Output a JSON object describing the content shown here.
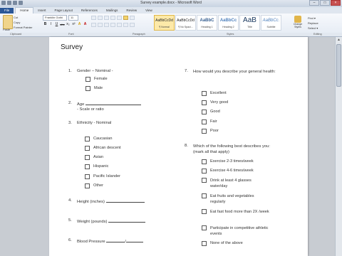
{
  "window": {
    "title": "Survey example.docx - Microsoft Word",
    "controls": [
      "–",
      "□",
      "×"
    ]
  },
  "ribbon": {
    "tabs": [
      "File",
      "Home",
      "Insert",
      "Page Layout",
      "References",
      "Mailings",
      "Review",
      "View"
    ],
    "clipboard": {
      "paste": "Paste",
      "cut": "Cut",
      "copy": "Copy",
      "format_painter": "Format Painter"
    },
    "font_name": "Franklin Gothi",
    "font_size": "11",
    "format_buttons": [
      "B",
      "I",
      "U",
      "abc",
      "x₂",
      "x²",
      "A",
      "A"
    ],
    "styles": [
      {
        "sample": "AaBbCcDd",
        "name": "¶ Normal",
        "active": true
      },
      {
        "sample": "AaBbCcDd",
        "name": "¶ No Spaci..."
      },
      {
        "sample": "AaBbC",
        "name": "Heading 1"
      },
      {
        "sample": "AaBbCc",
        "name": "Heading 2"
      },
      {
        "sample": "AaB",
        "name": "Title"
      },
      {
        "sample": "AaBbCc.",
        "name": "Subtitle"
      }
    ],
    "change_styles": "Change Styles",
    "editing": [
      "Find ▾",
      "Replace",
      "Select ▾"
    ],
    "group_labels": [
      "Clipboard",
      "Font",
      "Paragraph",
      "Styles",
      "Editing"
    ]
  },
  "document": {
    "heading": "Survey",
    "left_column": [
      {
        "num": "1.",
        "text": "Gender – Nominal -",
        "options": [
          "Female",
          "Male"
        ]
      },
      {
        "num": "2.",
        "text": "Age",
        "subtext": "- Scale or ratio",
        "blank": true
      },
      {
        "num": "3.",
        "text": "Ethnicity - Nominal",
        "options": [
          "Caucasian",
          "African descent",
          "Asian",
          "Hispanic",
          "Pacific Islander",
          "Other"
        ]
      },
      {
        "num": "4.",
        "text": "Height (inches)",
        "blank": true
      },
      {
        "num": "5.",
        "text": "Weight (pounds)",
        "blank": true
      },
      {
        "num": "6.",
        "text": "Blood Pressure",
        "blank": true,
        "separator": "/"
      }
    ],
    "right_column": [
      {
        "num": "7.",
        "text": "How would you describe your general health:",
        "options": [
          "Excellent",
          "Very good",
          "Good",
          "Fair",
          "Poor"
        ]
      },
      {
        "num": "8.",
        "text": "Which of the following best describes you: (mark all that apply)",
        "options": [
          "Exercise 2-3 times/week",
          "Exercise 4-6 times/week",
          "Drink at least 4 glasses water/day",
          "Eat fruits and vegetables regularly",
          "Eat fast food more than 2X /week",
          "Participate in competitive athletic events",
          "None of the above"
        ]
      }
    ]
  },
  "colors": {
    "file_tab": "#2b5797",
    "ribbon_bg": "#e7edf5",
    "workspace": "#c8ccd2",
    "close_button": "#c75050"
  }
}
